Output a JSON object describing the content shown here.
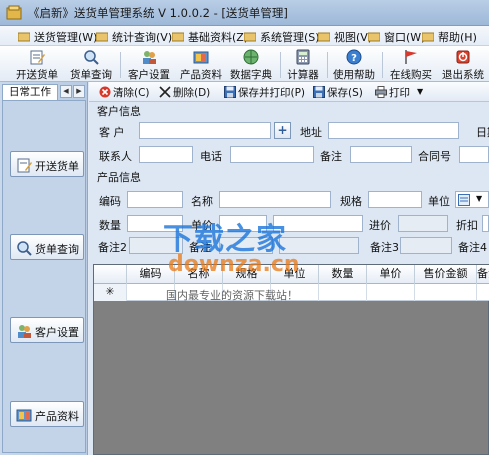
{
  "window": {
    "title": "《启新》送货单管理系统 V 1.0.0.2 - [送货单管理]"
  },
  "menu": [
    {
      "label": "送货管理(W)",
      "icon": "folder-icon"
    },
    {
      "label": "统计查询(V)",
      "icon": "folder-icon"
    },
    {
      "label": "基础资料(Z)",
      "icon": "folder-icon"
    },
    {
      "label": "系统管理(S)",
      "icon": "folder-icon"
    },
    {
      "label": "视图(V)",
      "icon": "folder-icon"
    },
    {
      "label": "窗口(W)",
      "icon": "folder-icon"
    },
    {
      "label": "帮助(H)",
      "icon": "folder-icon"
    }
  ],
  "toolbar": [
    {
      "label": "开送货单",
      "icon": "edit-form-icon"
    },
    {
      "label": "货单查询",
      "icon": "magnifier-icon"
    },
    {
      "label": "客户设置",
      "icon": "customer-icon"
    },
    {
      "label": "产品资料",
      "icon": "product-icon"
    },
    {
      "label": "数据字典",
      "icon": "globe-icon"
    },
    {
      "label": "计算器",
      "icon": "calculator-icon"
    },
    {
      "label": "使用帮助",
      "icon": "help-icon"
    },
    {
      "label": "在线购买",
      "icon": "flag-icon"
    },
    {
      "label": "退出系统",
      "icon": "exit-icon"
    }
  ],
  "left_panel": {
    "tab": "日常工作",
    "buttons": [
      "开送货单",
      "货单查询",
      "客户设置",
      "产品资料"
    ]
  },
  "form_toolbar": [
    {
      "label": "清除(C)",
      "icon": "clear-icon"
    },
    {
      "label": "删除(D)",
      "icon": "delete-x-icon"
    },
    {
      "label": "保存并打印(P)",
      "icon": "save-print-icon"
    },
    {
      "label": "保存(S)",
      "icon": "save-icon"
    },
    {
      "label": "打印",
      "icon": "printer-icon"
    }
  ],
  "customer_info": {
    "section": "客户信息",
    "customer_label": "客 户",
    "address_label": "地址",
    "date_label": "日期",
    "contact_label": "联系人",
    "phone_label": "电话",
    "note_label": "备注",
    "contract_label": "合同号"
  },
  "product_info": {
    "section": "产品信息",
    "code_label": "编码",
    "name_label": "名称",
    "spec_label": "规格",
    "unit_label": "单位",
    "qty_label": "数量",
    "unit_price_label": "单价",
    "cost_label": "进价",
    "discount_label": "折扣",
    "note2_label": "备注2",
    "note1_label": "备注",
    "note3_label": "备注3",
    "note4_label": "备注4"
  },
  "grid": {
    "columns": [
      "编码",
      "名称",
      "规格",
      "单位",
      "数量",
      "单价",
      "售价金额",
      "备注"
    ],
    "new_row_marker": "✳"
  },
  "watermark": {
    "main": "下载之家",
    "url": "downza.cn",
    "sub": "国内最专业的资源下载站！"
  },
  "colors": {
    "title_bar": "#9db8d8",
    "panel": "#c4d4e8",
    "grid_empty": "#808080",
    "watermark_blue": "#2078dc",
    "watermark_orange": "#e87814"
  }
}
